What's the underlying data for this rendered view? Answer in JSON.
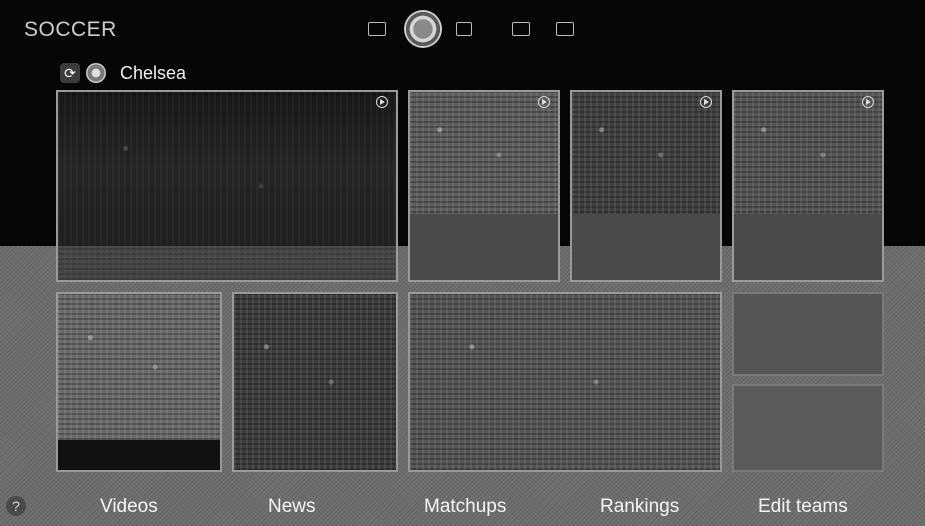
{
  "header": {
    "title": "SOCCER",
    "nav_icons": [
      "news-icon",
      "soccer-ball-icon",
      "multi-screen-icon",
      "tv-icon",
      "apps-icon"
    ],
    "active_icon": "soccer-ball-icon"
  },
  "team": {
    "name": "Chelsea",
    "icons": [
      "refresh-icon",
      "chelsea-crest-icon"
    ]
  },
  "tiles": [
    {
      "kind": "video",
      "icon": "play-icon"
    },
    {
      "kind": "video",
      "icon": "play-icon"
    },
    {
      "kind": "video",
      "icon": "play-icon"
    },
    {
      "kind": "video",
      "icon": "play-icon"
    },
    {
      "kind": "news"
    },
    {
      "kind": "news"
    },
    {
      "kind": "news"
    },
    {
      "kind": "empty"
    },
    {
      "kind": "empty"
    }
  ],
  "bottom_menu": {
    "help_label": "?",
    "items": [
      "Videos",
      "News",
      "Matchups",
      "Rankings",
      "Edit teams"
    ]
  },
  "colors": {
    "upper_background": "#060606",
    "lower_background": "#6e6e6e",
    "tile_border": "#9a9a9a",
    "text": "#f5f5f5"
  }
}
